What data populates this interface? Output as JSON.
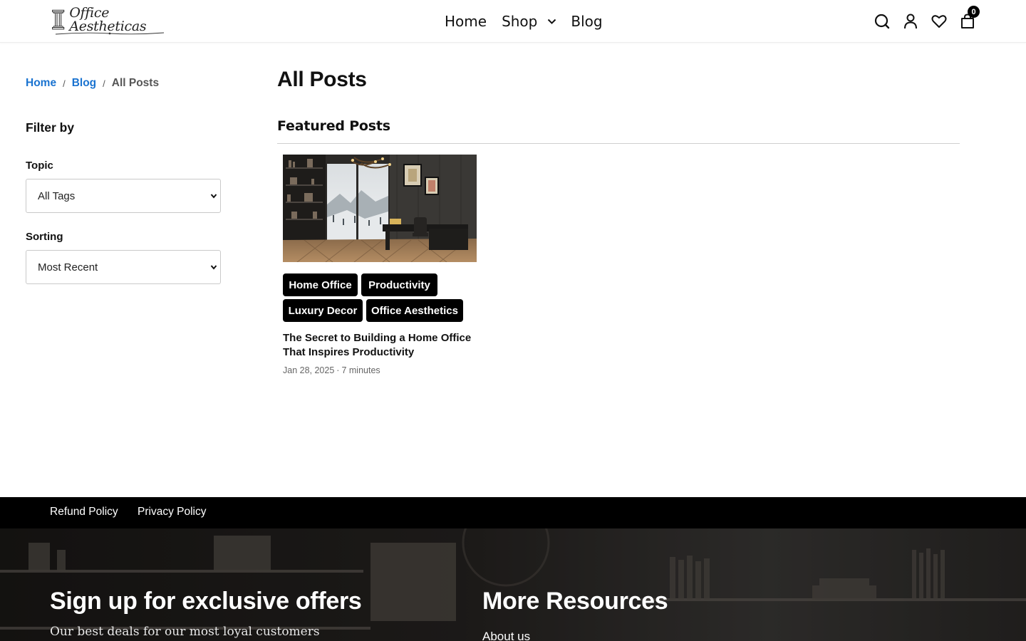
{
  "brand": {
    "name": "Office Aestheticas"
  },
  "nav": {
    "home": "Home",
    "shop": "Shop",
    "blog": "Blog"
  },
  "header_icons": {
    "search": "search-icon",
    "account": "user-icon",
    "wishlist": "heart-icon",
    "cart": "bag-icon",
    "cart_count": "0"
  },
  "breadcrumb": {
    "home": "Home",
    "sep": "/",
    "blog": "Blog",
    "current": "All Posts"
  },
  "sidebar": {
    "filter_title": "Filter by",
    "topic_label": "Topic",
    "topic_value": "All Tags",
    "sorting_label": "Sorting",
    "sorting_value": "Most Recent"
  },
  "main": {
    "title": "All Posts",
    "featured_title": "Featured Posts",
    "posts": [
      {
        "tags": [
          "Home Office",
          "Productivity",
          "Luxury Decor",
          "Office Aesthetics"
        ],
        "title": "The Secret to Building a Home Office That Inspires Productivity",
        "date": "Jan 28, 2025",
        "meta_sep": "·",
        "read_time": "7 minutes"
      }
    ]
  },
  "footer": {
    "links": [
      "Refund Policy",
      "Privacy Policy"
    ],
    "signup_title": "Sign up for exclusive offers",
    "signup_sub": "Our best deals for our most loyal customers",
    "resources_title": "More Resources",
    "resources_first_link": "About us"
  },
  "colors": {
    "link_blue": "#1a73d0",
    "tag_bg": "#000000",
    "footer_bg": "#000000"
  }
}
